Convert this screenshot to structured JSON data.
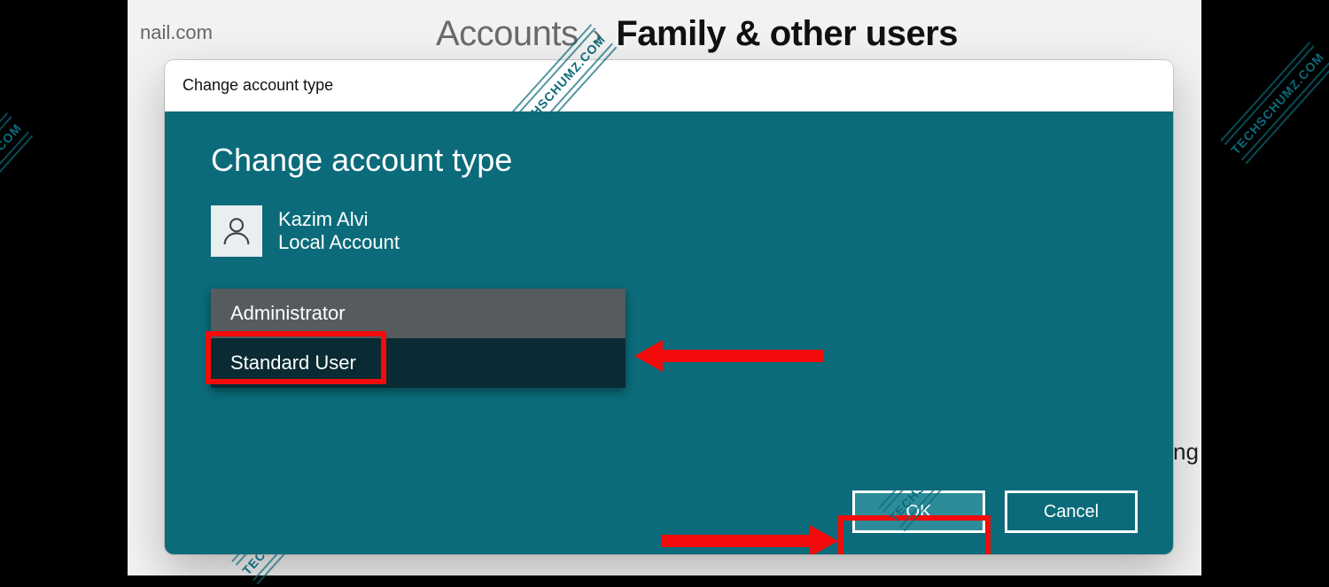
{
  "header": {
    "email_fragment": "nail.com",
    "breadcrumb_parent": "Accounts",
    "breadcrumb_sep": "›",
    "breadcrumb_current": "Family & other users",
    "bg_text_fragment": "ng"
  },
  "dialog": {
    "window_title": "Change account type",
    "heading": "Change account type",
    "user": {
      "name": "Kazim Alvi",
      "type": "Local Account"
    },
    "options": [
      {
        "label": "Administrator",
        "selected": true
      },
      {
        "label": "Standard User",
        "selected": false
      }
    ],
    "buttons": {
      "ok": "OK",
      "cancel": "Cancel"
    }
  },
  "annotations": {
    "watermark": "TECHSCHUMZ.COM",
    "highlight_color": "#f40b0b"
  }
}
